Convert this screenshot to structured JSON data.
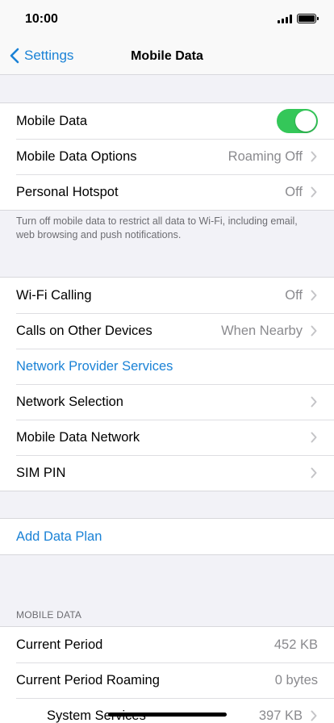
{
  "status": {
    "time": "10:00",
    "battery_level": 1.0
  },
  "nav": {
    "back_label": "Settings",
    "title": "Mobile Data"
  },
  "group1": {
    "rows": [
      {
        "label": "Mobile Data",
        "toggle_on": true
      },
      {
        "label": "Mobile Data Options",
        "value": "Roaming Off"
      },
      {
        "label": "Personal Hotspot",
        "value": "Off"
      }
    ],
    "footer": "Turn off mobile data to restrict all data to Wi-Fi, including email, web browsing and push notifications."
  },
  "group2": {
    "rows": [
      {
        "label": "Wi-Fi Calling",
        "value": "Off"
      },
      {
        "label": "Calls on Other Devices",
        "value": "When Nearby"
      },
      {
        "label": "Network Provider Services"
      },
      {
        "label": "Network Selection"
      },
      {
        "label": "Mobile Data Network"
      },
      {
        "label": "SIM PIN"
      }
    ]
  },
  "group3": {
    "rows": [
      {
        "label": "Add Data Plan"
      }
    ]
  },
  "usage": {
    "header": "MOBILE DATA",
    "rows": [
      {
        "label": "Current Period",
        "value": "452 KB"
      },
      {
        "label": "Current Period Roaming",
        "value": "0 bytes"
      },
      {
        "label": "System Services",
        "value": "397 KB"
      }
    ]
  },
  "colors": {
    "accent": "#1a82d6",
    "toggle_on": "#34c759",
    "background": "#f2f2f7"
  }
}
